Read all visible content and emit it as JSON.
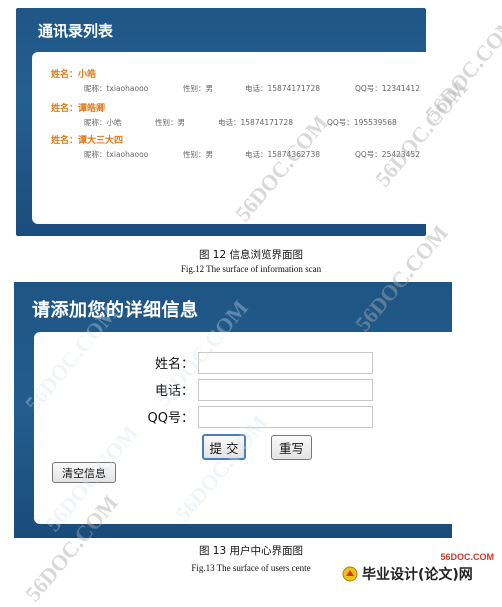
{
  "fig12": {
    "window_title": "通讯录列表",
    "contacts": [
      {
        "name": "姓名：小皓",
        "nickname": "昵称：txiaohaooo",
        "gender": "性别：男",
        "phone": "电话：15874171728",
        "qq": "QQ号：12341412"
      },
      {
        "name": "姓名：谭皓卿",
        "nickname": "昵称：小皓",
        "gender": "性别：男",
        "phone": "电话：15874171728",
        "qq": "QQ号：195539568"
      },
      {
        "name": "姓名：谭大三大四",
        "nickname": "昵称：txiaohaooo",
        "gender": "性别：男",
        "phone": "电话：15874362738",
        "qq": "QQ号：25423452"
      }
    ],
    "caption_zh": "图 12  信息浏览界面图",
    "caption_en": "Fig.12     The surface of information scan"
  },
  "fig13": {
    "window_title": "请添加您的详细信息",
    "fields": [
      {
        "label": "姓名：",
        "value": ""
      },
      {
        "label": "电话：",
        "value": ""
      },
      {
        "label": "QQ号：",
        "value": ""
      }
    ],
    "submit_label": "提 交",
    "reset_label": "重写",
    "clear_label": "清空信息",
    "caption_zh": "图 13  用户中心界面图",
    "caption_en": "Fig.13     The surface of users cente"
  },
  "watermark": {
    "text": "56DOC.COM",
    "site": "56DOC.COM",
    "brand": "毕业设计(论文)网"
  }
}
